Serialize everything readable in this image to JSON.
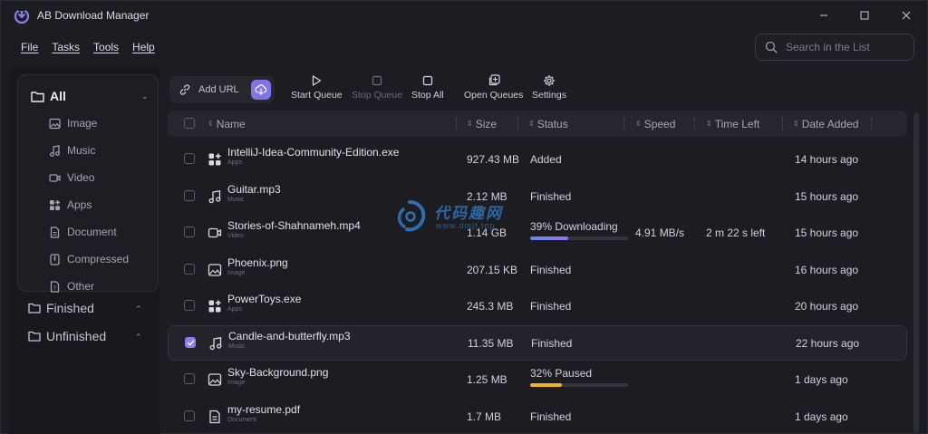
{
  "app": {
    "title": "AB Download Manager"
  },
  "menu": {
    "items": [
      "File",
      "Tasks",
      "Tools",
      "Help"
    ]
  },
  "search": {
    "placeholder": "Search in the List"
  },
  "sidebar": {
    "header": "All",
    "categories": [
      {
        "label": "Image",
        "icon": "image-icon"
      },
      {
        "label": "Music",
        "icon": "music-icon"
      },
      {
        "label": "Video",
        "icon": "video-icon"
      },
      {
        "label": "Apps",
        "icon": "apps-icon"
      },
      {
        "label": "Document",
        "icon": "document-icon"
      },
      {
        "label": "Compressed",
        "icon": "compressed-icon"
      },
      {
        "label": "Other",
        "icon": "other-icon"
      }
    ],
    "groups": [
      {
        "label": "Finished"
      },
      {
        "label": "Unfinished"
      }
    ]
  },
  "toolbar": {
    "add_url": "Add URL",
    "start_queue": "Start Queue",
    "stop_queue": "Stop Queue",
    "stop_all": "Stop All",
    "open_queues": "Open Queues",
    "settings": "Settings"
  },
  "table": {
    "columns": {
      "name": "Name",
      "size": "Size",
      "status": "Status",
      "speed": "Speed",
      "time_left": "Time Left",
      "date_added": "Date Added"
    },
    "rows": [
      {
        "name": "IntelliJ-Idea-Community-Edition.exe",
        "type": "Apps",
        "size": "927.43 MB",
        "status": "Added",
        "speed": "",
        "time_left": "",
        "date": "14 hours ago",
        "checked": false
      },
      {
        "name": "Guitar.mp3",
        "type": "Music",
        "size": "2.12 MB",
        "status": "Finished",
        "speed": "",
        "time_left": "",
        "date": "15 hours ago",
        "checked": false
      },
      {
        "name": "Stories-of-Shahnameh.mp4",
        "type": "Video",
        "size": "1.14 GB",
        "status": "39% Downloading",
        "progress": 0.39,
        "speed": "4.91 MB/s",
        "time_left": "2 m 22 s left",
        "date": "15 hours ago",
        "checked": false
      },
      {
        "name": "Phoenix.png",
        "type": "Image",
        "size": "207.15 KB",
        "status": "Finished",
        "speed": "",
        "time_left": "",
        "date": "16 hours ago",
        "checked": false
      },
      {
        "name": "PowerToys.exe",
        "type": "Apps",
        "size": "245.3 MB",
        "status": "Finished",
        "speed": "",
        "time_left": "",
        "date": "20 hours ago",
        "checked": false
      },
      {
        "name": "Candle-and-butterfly.mp3",
        "type": "Music",
        "size": "11.35 MB",
        "status": "Finished",
        "speed": "",
        "time_left": "",
        "date": "22 hours ago",
        "checked": true
      },
      {
        "name": "Sky-Background.png",
        "type": "Image",
        "size": "1.25 MB",
        "status": "32% Paused",
        "progress": 0.32,
        "speed": "",
        "time_left": "",
        "date": "1 days ago",
        "checked": false
      },
      {
        "name": "my-resume.pdf",
        "type": "Document",
        "size": "1.7 MB",
        "status": "Finished",
        "speed": "",
        "time_left": "",
        "date": "1 days ago",
        "checked": false
      }
    ]
  },
  "watermark": {
    "text": "代码趣网",
    "url": "www.dmjf.top"
  },
  "colors": {
    "accent": "#8b7ff0",
    "downloading_gradient": [
      "#5b8cf0",
      "#9b6cf0"
    ],
    "paused": "#f0b429",
    "background": "#1c1c21"
  }
}
